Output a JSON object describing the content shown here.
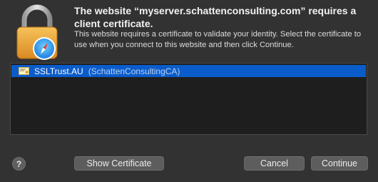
{
  "dialog": {
    "title": "The website “myserver.schattenconsulting.com” requires a client certificate.",
    "message": "This website requires a certificate to validate your identity. Select the certificate to use when you connect to this website and then click Continue."
  },
  "certificates": [
    {
      "name": "SSLTrust.AU",
      "issuer": "(SchattenConsultingCA)",
      "selected": true
    }
  ],
  "buttons": {
    "help": "?",
    "show_certificate": "Show Certificate",
    "cancel": "Cancel",
    "continue": "Continue"
  },
  "colors": {
    "background": "#323232",
    "selection": "#0b5ccb",
    "list_background": "#1e1e1e"
  },
  "icons": {
    "dialog_icon": "safari-lock-icon",
    "certificate_icon": "certificate-icon"
  }
}
